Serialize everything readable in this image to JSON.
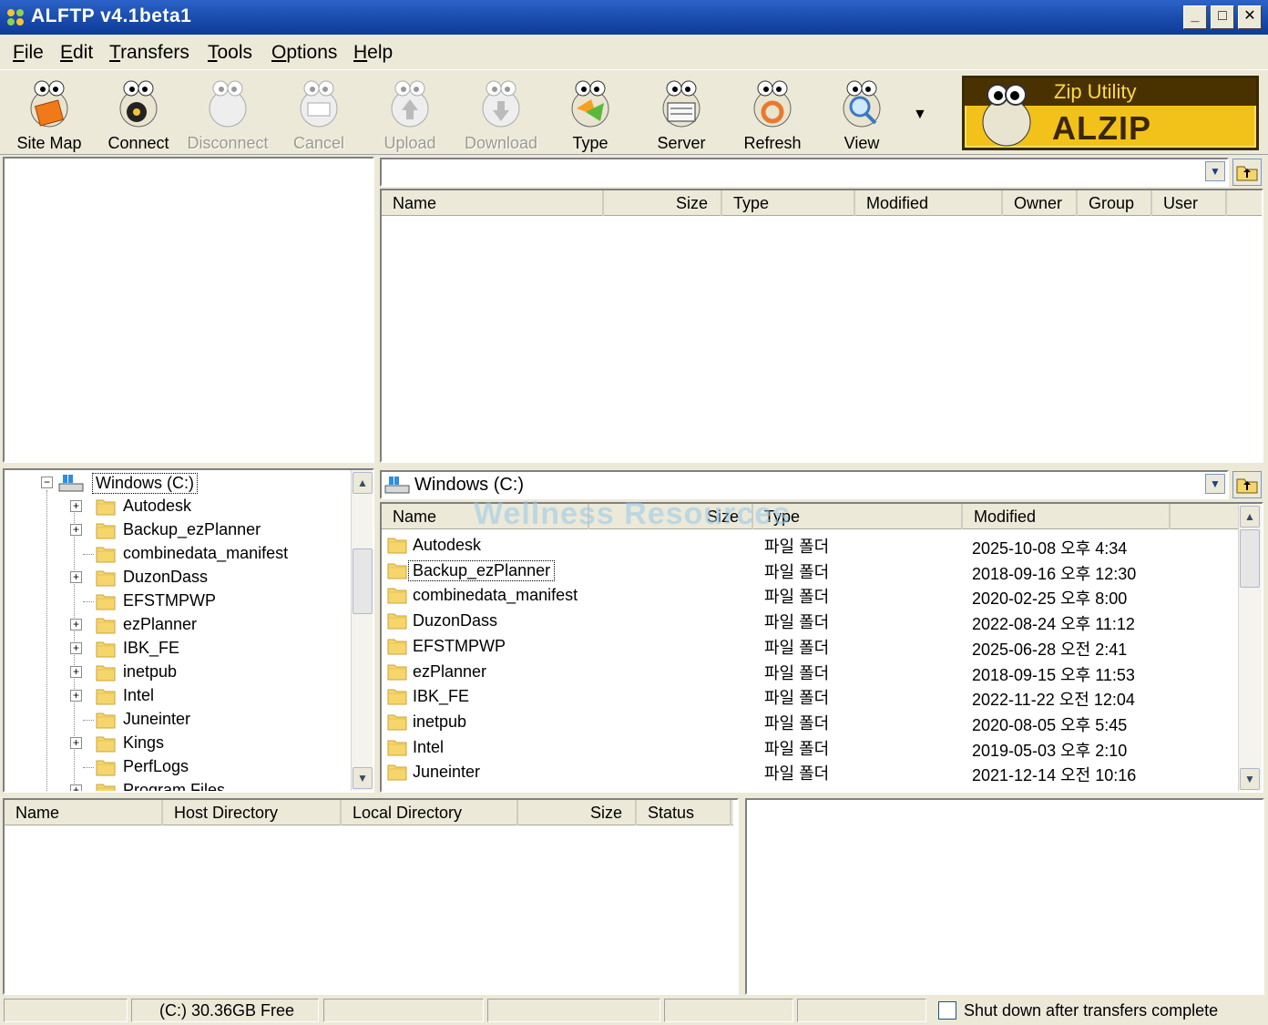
{
  "window": {
    "title": "ALFTP v4.1beta1"
  },
  "menu": [
    "File",
    "Edit",
    "Transfers",
    "Tools",
    "Options",
    "Help"
  ],
  "toolbar": {
    "site_map": "Site Map",
    "connect": "Connect",
    "disconnect": "Disconnect",
    "cancel": "Cancel",
    "upload": "Upload",
    "download": "Download",
    "type": "Type",
    "server": "Server",
    "refresh": "Refresh",
    "view": "View"
  },
  "banner": {
    "line1": "Zip Utility",
    "line2": "ALZIP"
  },
  "remote": {
    "path": "",
    "columns": [
      "Name",
      "Size",
      "Type",
      "Modified",
      "Owner",
      "Group",
      "User"
    ]
  },
  "local": {
    "drive": "Windows (C:)",
    "columns": [
      "Name",
      "Size",
      "Type",
      "Modified"
    ],
    "tree": [
      {
        "name": "Autodesk",
        "expandable": true
      },
      {
        "name": "Backup_ezPlanner",
        "expandable": true
      },
      {
        "name": "combinedata_manifest",
        "expandable": false
      },
      {
        "name": "DuzonDass",
        "expandable": true
      },
      {
        "name": "EFSTMPWP",
        "expandable": false
      },
      {
        "name": "ezPlanner",
        "expandable": true
      },
      {
        "name": "IBK_FE",
        "expandable": true
      },
      {
        "name": "inetpub",
        "expandable": true
      },
      {
        "name": "Intel",
        "expandable": true
      },
      {
        "name": "Juneinter",
        "expandable": false
      },
      {
        "name": "Kings",
        "expandable": true
      },
      {
        "name": "PerfLogs",
        "expandable": false
      },
      {
        "name": "Program Files",
        "expandable": true
      }
    ],
    "files": [
      {
        "name": "Autodesk",
        "type": "파일 폴더",
        "modified": "2025-10-08 오후 4:34"
      },
      {
        "name": "Backup_ezPlanner",
        "type": "파일 폴더",
        "modified": "2018-09-16 오후 12:30"
      },
      {
        "name": "combinedata_manifest",
        "type": "파일 폴더",
        "modified": "2020-02-25 오후 8:00"
      },
      {
        "name": "DuzonDass",
        "type": "파일 폴더",
        "modified": "2022-08-24 오후 11:12"
      },
      {
        "name": "EFSTMPWP",
        "type": "파일 폴더",
        "modified": "2025-06-28 오전 2:41"
      },
      {
        "name": "ezPlanner",
        "type": "파일 폴더",
        "modified": "2018-09-15 오후 11:53"
      },
      {
        "name": "IBK_FE",
        "type": "파일 폴더",
        "modified": "2022-11-22 오전 12:04"
      },
      {
        "name": "inetpub",
        "type": "파일 폴더",
        "modified": "2020-08-05 오후 5:45"
      },
      {
        "name": "Intel",
        "type": "파일 폴더",
        "modified": "2019-05-03 오후 2:10"
      },
      {
        "name": "Juneinter",
        "type": "파일 폴더",
        "modified": "2021-12-14 오전 10:16"
      }
    ]
  },
  "queue": {
    "columns": [
      "Name",
      "Host Directory",
      "Local Directory",
      "Size",
      "Status"
    ]
  },
  "status": {
    "free_space": "(C:)  30.36GB Free",
    "shutdown_label": "Shut down after transfers complete"
  },
  "watermark": "Wellness Resources",
  "colors": {
    "title_bar": "#1c4fb0",
    "banner_bg": "#f2c21a",
    "folder": "#f6d66c",
    "chrome": "#ece9d8"
  }
}
